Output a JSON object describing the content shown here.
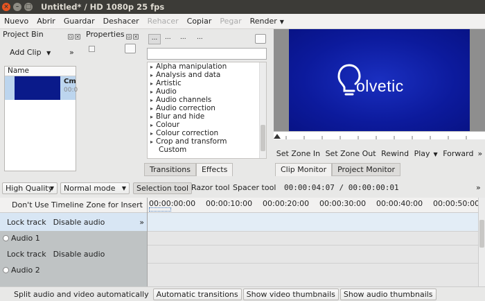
{
  "window": {
    "title": "Untitled* / HD 1080p 25 fps"
  },
  "menu": {
    "items": [
      {
        "label": "Nuevo",
        "disabled": false
      },
      {
        "label": "Abrir",
        "disabled": false
      },
      {
        "label": "Guardar",
        "disabled": false
      },
      {
        "label": "Deshacer",
        "disabled": false
      },
      {
        "label": "Rehacer",
        "disabled": true
      },
      {
        "label": "Copiar",
        "disabled": false
      },
      {
        "label": "Pegar",
        "disabled": true
      },
      {
        "label": "Render",
        "disabled": false
      }
    ]
  },
  "project_bin": {
    "title": "Project Bin",
    "add_clip": "Add Clip",
    "column_name": "Name",
    "clip": {
      "name": "Cm",
      "duration": "00:0"
    }
  },
  "properties": {
    "title": "Properties"
  },
  "effects": {
    "toolbar_dots": [
      "...",
      "...",
      "...",
      "..."
    ],
    "search_placeholder": "",
    "items": [
      "Alpha manipulation",
      "Analysis and data",
      "Artistic",
      "Audio",
      "Audio channels",
      "Audio correction",
      "Blur and hide",
      "Colour",
      "Colour correction",
      "Crop and transform",
      "Custom"
    ],
    "tabs": [
      "Transitions",
      "Effects"
    ]
  },
  "monitor": {
    "logo_text": "olvetic",
    "buttons": [
      "Set Zone In",
      "Set Zone Out",
      "Rewind",
      "Play",
      "Forward"
    ],
    "tabs": [
      "Clip Monitor",
      "Project Monitor"
    ]
  },
  "toolbar": {
    "quality": "High Quality",
    "mode": "Normal mode",
    "selection_tool": "Selection tool",
    "razor_tool": "Razor tool",
    "spacer_tool": "Spacer tool",
    "timecode": "00:00:04:07 / 00:00:00:01"
  },
  "timeline": {
    "zone_label": "Don't Use Timeline Zone for Insert",
    "ticks": [
      "00:00:00:00",
      "00:00:10:00",
      "00:00:20:00",
      "00:00:30:00",
      "00:00:40:00",
      "00:00:50:00"
    ],
    "tracks": [
      {
        "lock": "Lock track",
        "audio": "Disable audio",
        "name": "Audio 1"
      },
      {
        "lock": "Lock track",
        "audio": "Disable audio",
        "name": "Audio 2"
      }
    ]
  },
  "status": {
    "split_audio": "Split audio and video automatically",
    "auto_transitions": "Automatic transitions",
    "show_video_thumbs": "Show video thumbnails",
    "show_audio_thumbs": "Show audio thumbnails"
  }
}
